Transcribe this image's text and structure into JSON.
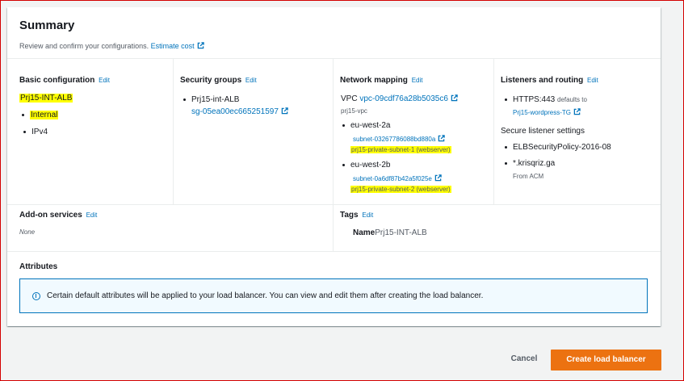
{
  "summary": {
    "title": "Summary",
    "description": "Review and confirm your configurations.",
    "estimate_cost_link": "Estimate cost"
  },
  "edit_label": "Edit",
  "basic_configuration": {
    "heading": "Basic configuration",
    "name": "Prj15-INT-ALB",
    "scheme": "Internal",
    "ip_type": "IPv4"
  },
  "security_groups": {
    "heading": "Security groups",
    "name": "Prj15-int-ALB",
    "id": "sg-05ea00ec665251597"
  },
  "network_mapping": {
    "heading": "Network mapping",
    "vpc_label": "VPC",
    "vpc_id": "vpc-09cdf76a28b5035c6",
    "vpc_name": "prj15-vpc",
    "zones": [
      {
        "az": "eu-west-2a",
        "subnet_id": "subnet-03267786088bd880a",
        "subnet_name": "prj15-private-subnet-1 (webserver)"
      },
      {
        "az": "eu-west-2b",
        "subnet_id": "subnet-0a6df87b42a5f025e",
        "subnet_name": "prj15-private-subnet-2 (webserver)"
      }
    ]
  },
  "listeners": {
    "heading": "Listeners and routing",
    "listener": "HTTPS:443",
    "defaults_to": "defaults to",
    "target_group": "Prj15-wordpress-TG",
    "secure_settings_heading": "Secure listener settings",
    "policy": "ELBSecurityPolicy-2016-08",
    "certificate": "*.krisqriz.ga",
    "certificate_source": "From ACM"
  },
  "addon_services": {
    "heading": "Add-on services",
    "value": "None"
  },
  "tags": {
    "heading": "Tags",
    "key": "Name",
    "value": "Prj15-INT-ALB"
  },
  "attributes": {
    "heading": "Attributes",
    "info_text": "Certain default attributes will be applied to your load balancer. You can view and edit them after creating the load balancer."
  },
  "footer": {
    "cancel_label": "Cancel",
    "create_label": "Create load balancer"
  },
  "colors": {
    "link": "#0073bb",
    "primary_button": "#ec7211",
    "highlight": "#ffff00",
    "info_border": "#0073bb"
  }
}
